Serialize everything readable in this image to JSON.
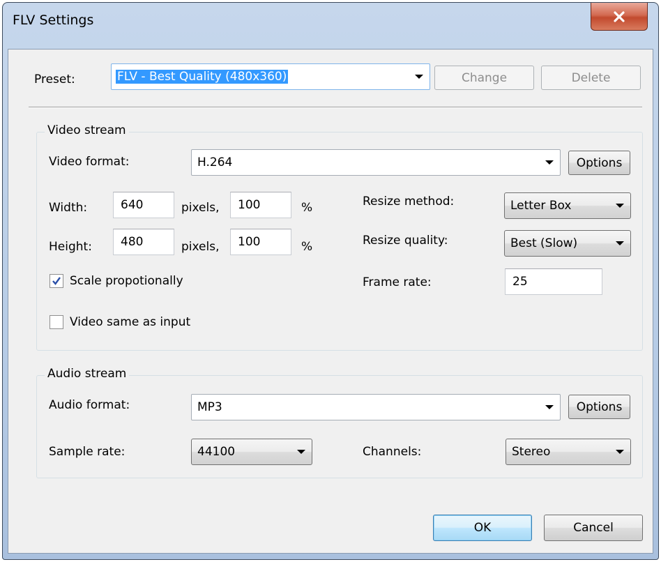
{
  "window": {
    "title": "FLV Settings"
  },
  "preset": {
    "label": "Preset:",
    "value": "FLV - Best Quality (480x360)",
    "change_label": "Change",
    "delete_label": "Delete"
  },
  "video": {
    "group_title": "Video stream",
    "format_label": "Video format:",
    "format_value": "H.264",
    "options_label": "Options",
    "width_label": "Width:",
    "width_px": "640",
    "width_pixels_suffix": "pixels,",
    "width_percent": "100",
    "width_percent_suffix": "%",
    "height_label": "Height:",
    "height_px": "480",
    "height_pixels_suffix": "pixels,",
    "height_percent": "100",
    "height_percent_suffix": "%",
    "resize_method_label": "Resize method:",
    "resize_method_value": "Letter Box",
    "resize_quality_label": "Resize quality:",
    "resize_quality_value": "Best (Slow)",
    "frame_rate_label": "Frame rate:",
    "frame_rate_value": "25",
    "scale_label": "Scale propotionally",
    "scale_checked": true,
    "same_as_input_label": "Video same as input",
    "same_as_input_checked": false
  },
  "audio": {
    "group_title": "Audio stream",
    "format_label": "Audio format:",
    "format_value": "MP3",
    "options_label": "Options",
    "sample_rate_label": "Sample rate:",
    "sample_rate_value": "44100",
    "channels_label": "Channels:",
    "channels_value": "Stereo"
  },
  "footer": {
    "ok_label": "OK",
    "cancel_label": "Cancel"
  },
  "colors": {
    "close_button": "#c24a2e",
    "selection": "#3399ff",
    "default_button_border": "#3c7fb1"
  },
  "icons": {
    "close": "close-icon",
    "dropdown": "chevron-down-icon",
    "check": "check-icon"
  }
}
